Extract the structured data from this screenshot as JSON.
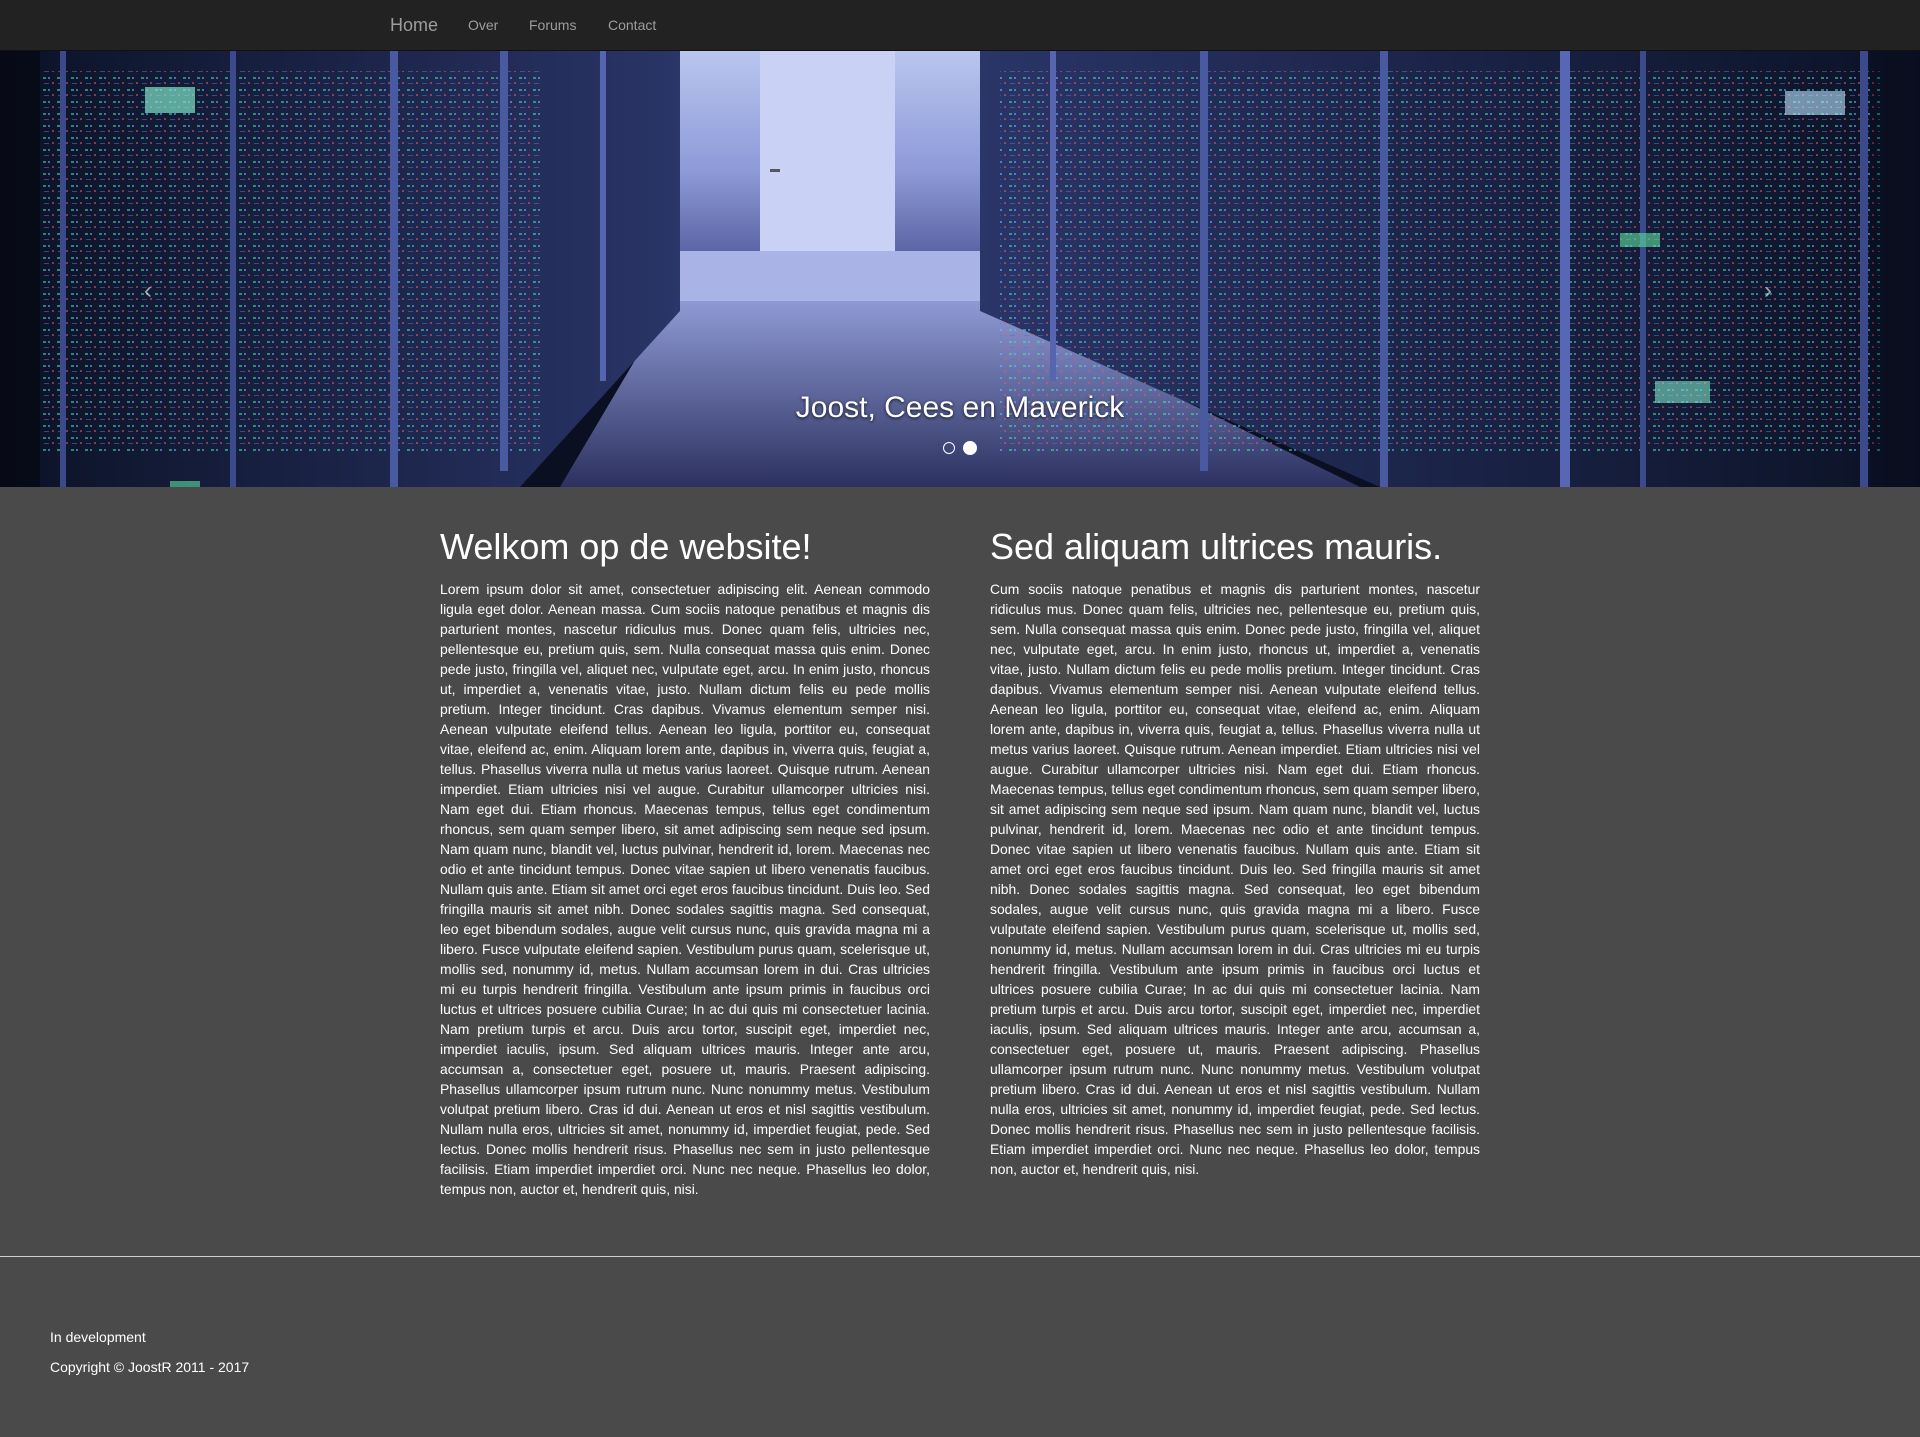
{
  "nav": {
    "brand": "Home",
    "links": [
      "Over",
      "Forums",
      "Contact"
    ]
  },
  "carousel": {
    "caption": "Joost, Cees en Maverick",
    "prev_glyph": "‹",
    "next_glyph": "›",
    "indicator_count": 2,
    "active_indicator": 2
  },
  "left_column": {
    "heading": "Welkom op de website!",
    "text": "Lorem ipsum dolor sit amet, consectetuer adipiscing elit. Aenean commodo ligula eget dolor. Aenean massa. Cum sociis natoque penatibus et magnis dis parturient montes, nascetur ridiculus mus. Donec quam felis, ultricies nec, pellentesque eu, pretium quis, sem. Nulla consequat massa quis enim. Donec pede justo, fringilla vel, aliquet nec, vulputate eget, arcu. In enim justo, rhoncus ut, imperdiet a, venenatis vitae, justo. Nullam dictum felis eu pede mollis pretium. Integer tincidunt. Cras dapibus. Vivamus elementum semper nisi. Aenean vulputate eleifend tellus. Aenean leo ligula, porttitor eu, consequat vitae, eleifend ac, enim. Aliquam lorem ante, dapibus in, viverra quis, feugiat a, tellus. Phasellus viverra nulla ut metus varius laoreet. Quisque rutrum. Aenean imperdiet. Etiam ultricies nisi vel augue. Curabitur ullamcorper ultricies nisi. Nam eget dui. Etiam rhoncus. Maecenas tempus, tellus eget condimentum rhoncus, sem quam semper libero, sit amet adipiscing sem neque sed ipsum. Nam quam nunc, blandit vel, luctus pulvinar, hendrerit id, lorem. Maecenas nec odio et ante tincidunt tempus. Donec vitae sapien ut libero venenatis faucibus. Nullam quis ante. Etiam sit amet orci eget eros faucibus tincidunt. Duis leo. Sed fringilla mauris sit amet nibh. Donec sodales sagittis magna. Sed consequat, leo eget bibendum sodales, augue velit cursus nunc, quis gravida magna mi a libero. Fusce vulputate eleifend sapien. Vestibulum purus quam, scelerisque ut, mollis sed, nonummy id, metus. Nullam accumsan lorem in dui. Cras ultricies mi eu turpis hendrerit fringilla. Vestibulum ante ipsum primis in faucibus orci luctus et ultrices posuere cubilia Curae; In ac dui quis mi consectetuer lacinia. Nam pretium turpis et arcu. Duis arcu tortor, suscipit eget, imperdiet nec, imperdiet iaculis, ipsum. Sed aliquam ultrices mauris. Integer ante arcu, accumsan a, consectetuer eget, posuere ut, mauris. Praesent adipiscing. Phasellus ullamcorper ipsum rutrum nunc. Nunc nonummy metus. Vestibulum volutpat pretium libero. Cras id dui. Aenean ut eros et nisl sagittis vestibulum. Nullam nulla eros, ultricies sit amet, nonummy id, imperdiet feugiat, pede. Sed lectus. Donec mollis hendrerit risus. Phasellus nec sem in justo pellentesque facilisis. Etiam imperdiet imperdiet orci. Nunc nec neque. Phasellus leo dolor, tempus non, auctor et, hendrerit quis, nisi."
  },
  "right_column": {
    "heading": "Sed aliquam ultrices mauris.",
    "text": "Cum sociis natoque penatibus et magnis dis parturient montes, nascetur ridiculus mus. Donec quam felis, ultricies nec, pellentesque eu, pretium quis, sem. Nulla consequat massa quis enim. Donec pede justo, fringilla vel, aliquet nec, vulputate eget, arcu. In enim justo, rhoncus ut, imperdiet a, venenatis vitae, justo. Nullam dictum felis eu pede mollis pretium. Integer tincidunt. Cras dapibus. Vivamus elementum semper nisi. Aenean vulputate eleifend tellus. Aenean leo ligula, porttitor eu, consequat vitae, eleifend ac, enim. Aliquam lorem ante, dapibus in, viverra quis, feugiat a, tellus. Phasellus viverra nulla ut metus varius laoreet. Quisque rutrum. Aenean imperdiet. Etiam ultricies nisi vel augue. Curabitur ullamcorper ultricies nisi. Nam eget dui. Etiam rhoncus. Maecenas tempus, tellus eget condimentum rhoncus, sem quam semper libero, sit amet adipiscing sem neque sed ipsum. Nam quam nunc, blandit vel, luctus pulvinar, hendrerit id, lorem. Maecenas nec odio et ante tincidunt tempus. Donec vitae sapien ut libero venenatis faucibus. Nullam quis ante. Etiam sit amet orci eget eros faucibus tincidunt. Duis leo. Sed fringilla mauris sit amet nibh. Donec sodales sagittis magna. Sed consequat, leo eget bibendum sodales, augue velit cursus nunc, quis gravida magna mi a libero. Fusce vulputate eleifend sapien. Vestibulum purus quam, scelerisque ut, mollis sed, nonummy id, metus. Nullam accumsan lorem in dui. Cras ultricies mi eu turpis hendrerit fringilla. Vestibulum ante ipsum primis in faucibus orci luctus et ultrices posuere cubilia Curae; In ac dui quis mi consectetuer lacinia. Nam pretium turpis et arcu. Duis arcu tortor, suscipit eget, imperdiet nec, imperdiet iaculis, ipsum. Sed aliquam ultrices mauris. Integer ante arcu, accumsan a, consectetuer eget, posuere ut, mauris. Praesent adipiscing. Phasellus ullamcorper ipsum rutrum nunc. Nunc nonummy metus. Vestibulum volutpat pretium libero. Cras id dui. Aenean ut eros et nisl sagittis vestibulum. Nullam nulla eros, ultricies sit amet, nonummy id, imperdiet feugiat, pede. Sed lectus. Donec mollis hendrerit risus. Phasellus nec sem in justo pellentesque facilisis. Etiam imperdiet imperdiet orci. Nunc nec neque. Phasellus leo dolor, tempus non, auctor et, hendrerit quis, nisi."
  },
  "footer": {
    "status": "In development",
    "copyright": "Copyright © JoostR 2011 - 2017"
  },
  "colors": {
    "navbar": "#222222",
    "background": "#4a4a4a",
    "nav_text": "#9d9d9d",
    "text": "#ffffff"
  }
}
